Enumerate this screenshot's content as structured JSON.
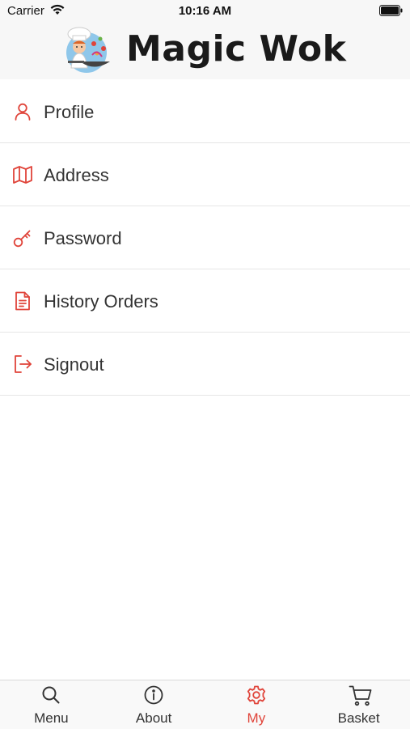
{
  "status_bar": {
    "carrier": "Carrier",
    "time": "10:16 AM"
  },
  "header": {
    "brand_name": "Magic Wok",
    "logo_icon": "chef-logo"
  },
  "menu": {
    "items": [
      {
        "label": "Profile",
        "icon": "user-icon"
      },
      {
        "label": "Address",
        "icon": "map-icon"
      },
      {
        "label": "Password",
        "icon": "key-icon"
      },
      {
        "label": "History Orders",
        "icon": "document-icon"
      },
      {
        "label": "Signout",
        "icon": "sign-out-icon"
      }
    ]
  },
  "tab_bar": {
    "tabs": [
      {
        "label": "Menu",
        "icon": "search-icon"
      },
      {
        "label": "About",
        "icon": "info-icon"
      },
      {
        "label": "My",
        "icon": "gear-icon",
        "active": true
      },
      {
        "label": "Basket",
        "icon": "cart-icon"
      }
    ]
  },
  "colors": {
    "accent": "#e0443a",
    "text": "#333333",
    "header_bg": "#f7f7f7",
    "divider": "#e6e6e6"
  }
}
